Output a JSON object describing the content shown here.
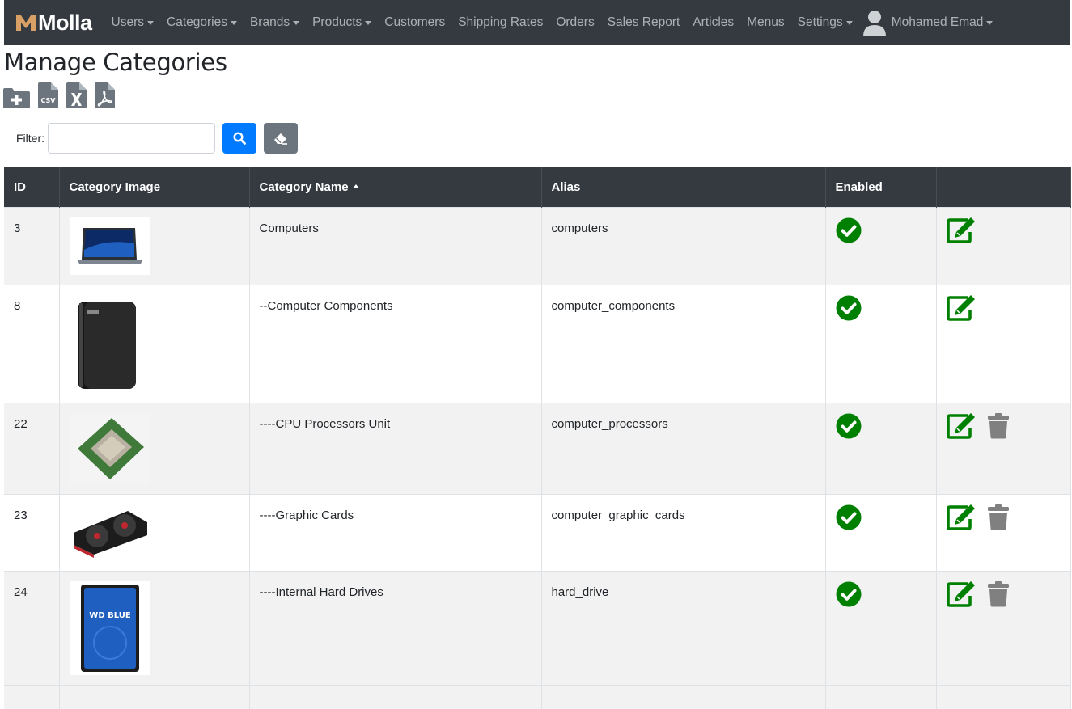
{
  "brand": {
    "name": "Molla"
  },
  "nav": [
    {
      "label": "Users",
      "dropdown": true
    },
    {
      "label": "Categories",
      "dropdown": true
    },
    {
      "label": "Brands",
      "dropdown": true
    },
    {
      "label": "Products",
      "dropdown": true
    },
    {
      "label": "Customers",
      "dropdown": false
    },
    {
      "label": "Shipping Rates",
      "dropdown": false
    },
    {
      "label": "Orders",
      "dropdown": false
    },
    {
      "label": "Sales Report",
      "dropdown": false
    },
    {
      "label": "Articles",
      "dropdown": false
    },
    {
      "label": "Menus",
      "dropdown": false
    },
    {
      "label": "Settings",
      "dropdown": true
    }
  ],
  "user": {
    "name": "Mohamed Emad"
  },
  "page": {
    "title": "Manage Categories"
  },
  "toolbar": {
    "icons": [
      "add-folder-icon",
      "csv-export-icon",
      "excel-export-icon",
      "pdf-export-icon"
    ]
  },
  "filter": {
    "label": "Filter:",
    "value": "",
    "placeholder": ""
  },
  "table": {
    "headers": {
      "id": "ID",
      "image": "Category Image",
      "name": "Category Name",
      "alias": "Alias",
      "enabled": "Enabled"
    },
    "sorted_by": "name",
    "sort_direction": "asc",
    "rows": [
      {
        "id": "3",
        "name": "Computers",
        "alias": "computers",
        "enabled": true,
        "image": "laptop",
        "deletable": false
      },
      {
        "id": "8",
        "name": "--Computer Components",
        "alias": "computer_components",
        "enabled": true,
        "image": "external-hard-drive",
        "deletable": false
      },
      {
        "id": "22",
        "name": "----CPU Processors Unit",
        "alias": "computer_processors",
        "enabled": true,
        "image": "cpu",
        "deletable": true
      },
      {
        "id": "23",
        "name": "----Graphic Cards",
        "alias": "computer_graphic_cards",
        "enabled": true,
        "image": "graphics-card",
        "deletable": true
      },
      {
        "id": "24",
        "name": "----Internal Hard Drives",
        "alias": "hard_drive",
        "enabled": true,
        "image": "wd-blue-hard-drive",
        "image_label": "WD BLUE",
        "deletable": true
      }
    ]
  },
  "colors": {
    "navbar": "#343a40",
    "brand_accent": "#d9a066",
    "enabled": "#008000",
    "edit": "#008000",
    "delete": "#808080",
    "primary": "#007bff",
    "secondary": "#6c757d"
  }
}
